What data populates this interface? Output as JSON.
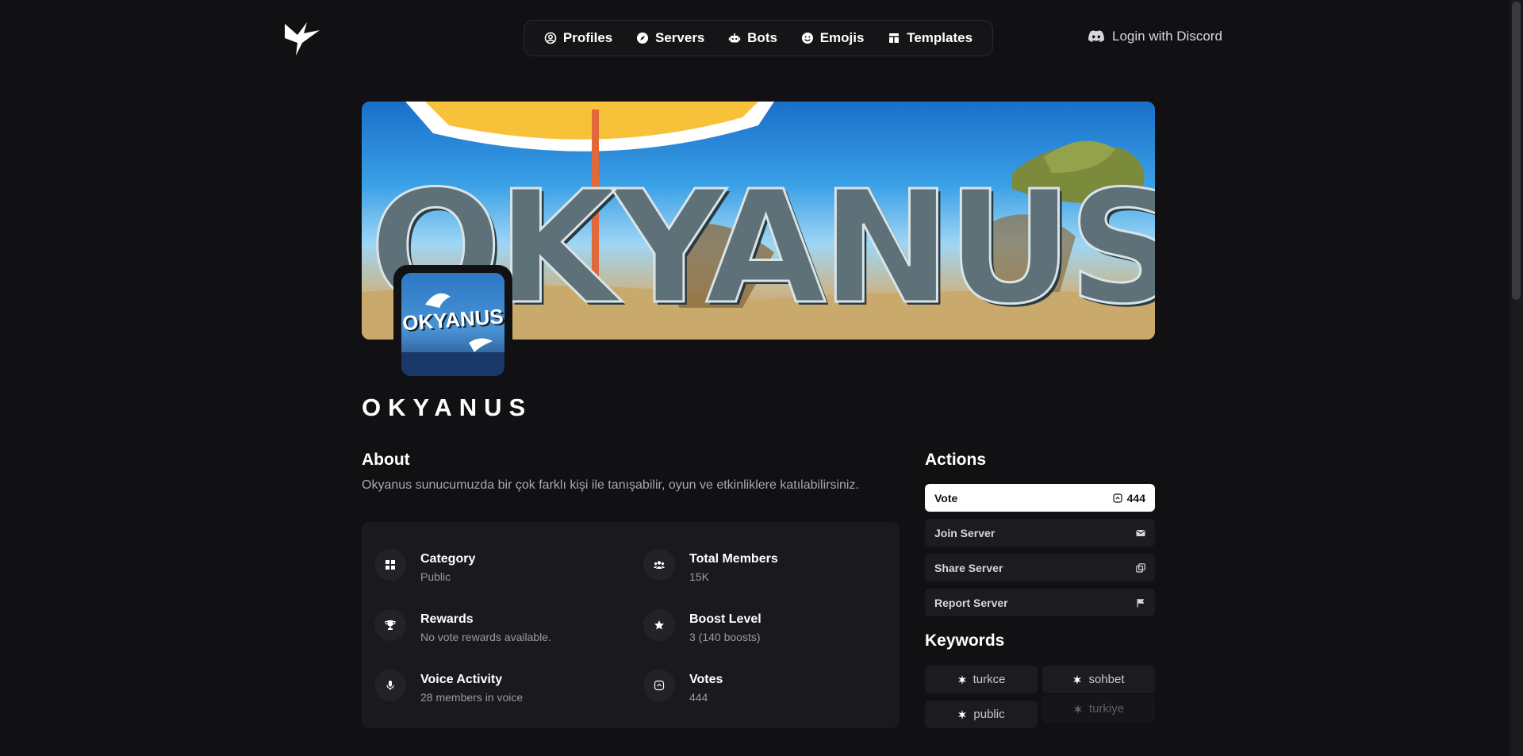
{
  "nav": {
    "items": [
      {
        "label": "Profiles",
        "icon": "user-circle-icon"
      },
      {
        "label": "Servers",
        "icon": "compass-icon"
      },
      {
        "label": "Bots",
        "icon": "robot-icon"
      },
      {
        "label": "Emojis",
        "icon": "smile-icon"
      },
      {
        "label": "Templates",
        "icon": "template-icon"
      }
    ],
    "login_label": "Login with Discord"
  },
  "banner": {
    "text": "OKYANUS"
  },
  "avatar": {
    "text": "OKYANUS"
  },
  "server": {
    "name": "OKYANUS"
  },
  "about": {
    "title": "About",
    "description": "Okyanus sunucumuzda bir çok farklı kişi ile tanışabilir, oyun ve etkinliklere katılabilirsiniz."
  },
  "info": [
    {
      "label": "Category",
      "value": "Public",
      "icon": "grid-icon"
    },
    {
      "label": "Total Members",
      "value": "15K",
      "icon": "users-icon"
    },
    {
      "label": "Rewards",
      "value": "No vote rewards available.",
      "icon": "trophy-icon"
    },
    {
      "label": "Boost Level",
      "value": "3 (140 boosts)",
      "icon": "star-icon"
    },
    {
      "label": "Voice Activity",
      "value": "28 members in voice",
      "icon": "microphone-icon"
    },
    {
      "label": "Votes",
      "value": "444",
      "icon": "vote-icon"
    }
  ],
  "actions": {
    "title": "Actions",
    "vote_label": "Vote",
    "vote_count": "444",
    "join_label": "Join Server",
    "share_label": "Share Server",
    "report_label": "Report Server"
  },
  "keywords": {
    "title": "Keywords",
    "items": [
      "turkce",
      "sohbet",
      "public",
      "turkiye"
    ]
  },
  "colors": {
    "background": "#111114",
    "card": "#1a1a1e",
    "button": "#1c1c20",
    "accent": "#ffffff"
  }
}
